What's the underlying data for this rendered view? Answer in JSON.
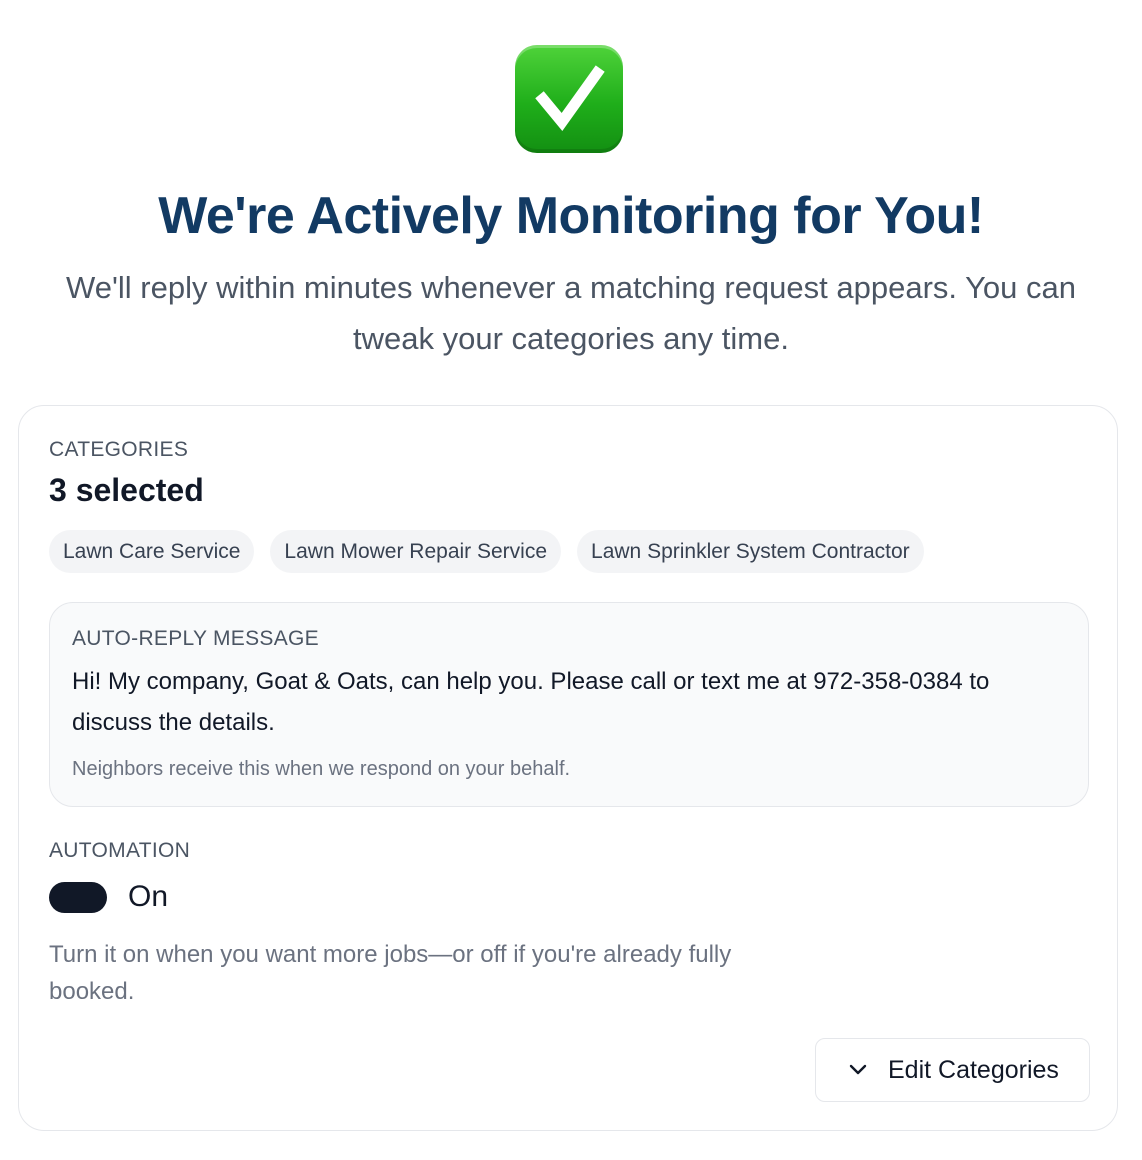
{
  "header": {
    "icon": "check-mark-button-icon",
    "title": "We're Actively Monitoring for You!",
    "subtitle": "We'll reply within minutes whenever a matching request appears. You can tweak your categories any time."
  },
  "categories": {
    "label": "CATEGORIES",
    "count_text": "3 selected",
    "items": [
      "Lawn Care Service",
      "Lawn Mower Repair Service",
      "Lawn Sprinkler System Contractor"
    ]
  },
  "auto_reply": {
    "label": "AUTO-REPLY MESSAGE",
    "message": "Hi! My company, Goat & Oats, can help you. Please call or text me at 972-358-0384 to discuss the details.",
    "note": "Neighbors receive this when we respond on your behalf."
  },
  "automation": {
    "label": "AUTOMATION",
    "state": "On",
    "enabled": true,
    "help": "Turn it on when you want more jobs—or off if you're already fully booked."
  },
  "actions": {
    "edit_label": "Edit Categories",
    "edit_icon": "chevron-down-icon"
  },
  "colors": {
    "title": "#123a63",
    "icon_green": "#1fae1a",
    "toggle_on": "#111827"
  }
}
